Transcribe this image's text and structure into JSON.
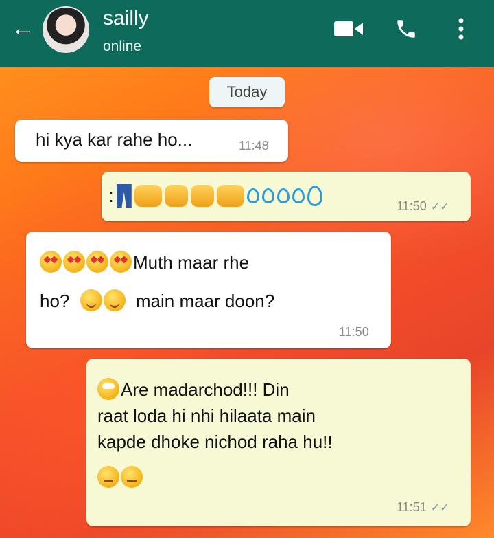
{
  "header": {
    "contact_name": "sailly",
    "status": "online",
    "back_glyph": "←",
    "icons": [
      "back-arrow-icon",
      "avatar",
      "video-call-icon",
      "phone-icon",
      "more-options-icon"
    ]
  },
  "date_chip": "Today",
  "messages": [
    {
      "text": "hi kya kar rahe ho...",
      "time": "11:48",
      "direction": "in"
    },
    {
      "prefix": ":",
      "time": "11:50",
      "direction": "out",
      "emoji": [
        "jeans",
        "fist-left",
        "raised-fist",
        "raised-fist",
        "fist-right",
        "sweat-drops",
        "sweat-drops",
        "droplet"
      ]
    },
    {
      "line1": "Muth maar rhe",
      "line2a": "ho?",
      "line2b": "main maar doon?",
      "time": "11:50",
      "direction": "in"
    },
    {
      "line1": "Are madarchod!!! Din",
      "line2": "raat loda hi nhi hilaata main",
      "line3": "kapde dhoke nichod raha hu!!",
      "time": "11:51",
      "direction": "out"
    }
  ],
  "colors": {
    "header": "#0e6b5b",
    "incoming": "#ffffff",
    "outgoing": "#f7f9d5",
    "tick": "#7a9ab0"
  }
}
